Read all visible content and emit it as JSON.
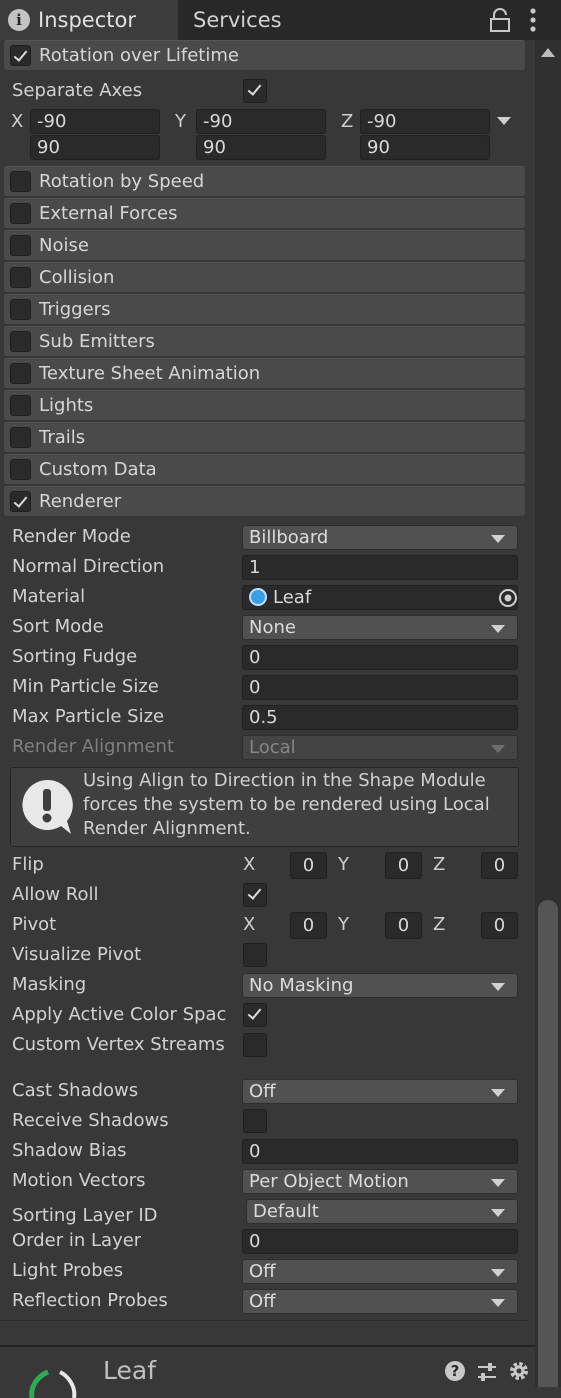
{
  "tabs": {
    "inspector": "Inspector",
    "services": "Services"
  },
  "rotation_module": {
    "label": "Rotation over Lifetime",
    "separate_axes_label": "Separate Axes",
    "x_label": "X",
    "y_label": "Y",
    "z_label": "Z",
    "x_min": "-90",
    "y_min": "-90",
    "z_min": "-90",
    "x_max": "90",
    "y_max": "90",
    "z_max": "90"
  },
  "modules": [
    "Rotation by Speed",
    "External Forces",
    "Noise",
    "Collision",
    "Triggers",
    "Sub Emitters",
    "Texture Sheet Animation",
    "Lights",
    "Trails",
    "Custom Data",
    "Renderer"
  ],
  "renderer": {
    "render_mode": {
      "label": "Render Mode",
      "value": "Billboard"
    },
    "normal_direction": {
      "label": "Normal Direction",
      "value": "1"
    },
    "material": {
      "label": "Material",
      "value": "Leaf"
    },
    "sort_mode": {
      "label": "Sort Mode",
      "value": "None"
    },
    "sorting_fudge": {
      "label": "Sorting Fudge",
      "value": "0"
    },
    "min_particle_size": {
      "label": "Min Particle Size",
      "value": "0"
    },
    "max_particle_size": {
      "label": "Max Particle Size",
      "value": "0.5"
    },
    "render_alignment": {
      "label": "Render Alignment",
      "value": "Local"
    },
    "help_text": "Using Align to Direction in the Shape Module forces the system to be rendered using Local Render Alignment.",
    "flip": {
      "label": "Flip",
      "x": "0",
      "y": "0",
      "z": "0"
    },
    "allow_roll": {
      "label": "Allow Roll"
    },
    "pivot": {
      "label": "Pivot",
      "x": "0",
      "y": "0",
      "z": "0"
    },
    "visualize_pivot": {
      "label": "Visualize Pivot"
    },
    "masking": {
      "label": "Masking",
      "value": "No Masking"
    },
    "apply_active_color_space": {
      "label": "Apply Active Color Spac"
    },
    "custom_vertex_streams": {
      "label": "Custom Vertex Streams"
    },
    "cast_shadows": {
      "label": "Cast Shadows",
      "value": "Off"
    },
    "receive_shadows": {
      "label": "Receive Shadows"
    },
    "shadow_bias": {
      "label": "Shadow Bias",
      "value": "0"
    },
    "motion_vectors": {
      "label": "Motion Vectors",
      "value": "Per Object Motion"
    },
    "sorting_layer_id": {
      "label": "Sorting Layer ID",
      "value": "Default"
    },
    "order_in_layer": {
      "label": "Order in Layer",
      "value": "0"
    },
    "light_probes": {
      "label": "Light Probes",
      "value": "Off"
    },
    "reflection_probes": {
      "label": "Reflection Probes",
      "value": "Off"
    }
  },
  "footer": {
    "title": "Leaf"
  },
  "icons": {
    "info": "info-icon",
    "lock": "lock-icon",
    "menu": "kebab-menu-icon",
    "material": "material-sphere-icon",
    "object_picker": "object-picker-icon",
    "warning": "warning-icon",
    "help": "help-icon",
    "presets": "presets-icon",
    "settings": "gear-icon"
  }
}
